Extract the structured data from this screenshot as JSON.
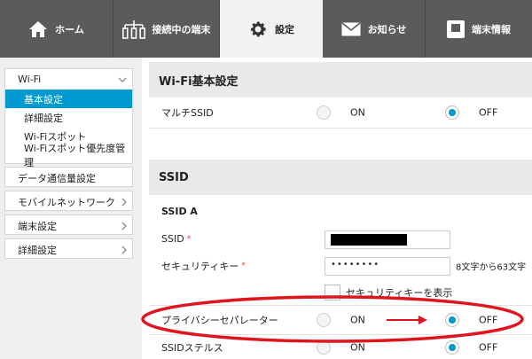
{
  "topnav": {
    "tabs": [
      {
        "label": "ホーム",
        "icon": "home-icon"
      },
      {
        "label": "接続中の端末",
        "icon": "devices-icon"
      },
      {
        "label": "設定",
        "icon": "gear-icon",
        "active": true
      },
      {
        "label": "お知らせ",
        "icon": "mail-icon"
      },
      {
        "label": "端末情報",
        "icon": "device-info-icon"
      }
    ]
  },
  "sidebar": {
    "wifi": {
      "label": "Wi-Fi",
      "items": [
        "基本設定",
        "詳細設定",
        "Wi-Fiスポット",
        "Wi-Fiスポット優先度管理"
      ]
    },
    "groups": [
      "データ通信量設定",
      "モバイルネットワーク",
      "端末設定",
      "詳細設定"
    ]
  },
  "main": {
    "section_basic": "Wi-Fi基本設定",
    "multi_ssid": {
      "label": "マルチSSID",
      "on": "ON",
      "off": "OFF",
      "selected": "OFF"
    },
    "section_ssid": "SSID",
    "ssid_a": "SSID A",
    "ssid": {
      "label": "SSID",
      "required": "*"
    },
    "security_key": {
      "label": "セキュリティキー",
      "required": "*",
      "value": "••••••••",
      "hint": "8文字から63文字"
    },
    "show_key": {
      "label": "セキュリティキーを表示",
      "checked": false
    },
    "privacy_separator": {
      "label": "プライバシーセパレーター",
      "on": "ON",
      "off": "OFF",
      "selected": "OFF"
    },
    "ssid_stealth": {
      "label": "SSIDステルス",
      "on": "ON",
      "off": "OFF",
      "selected": "OFF"
    }
  },
  "colors": {
    "accent": "#0099d0",
    "nav_bg": "#5b5b5b",
    "annotation": "#e0141c"
  }
}
